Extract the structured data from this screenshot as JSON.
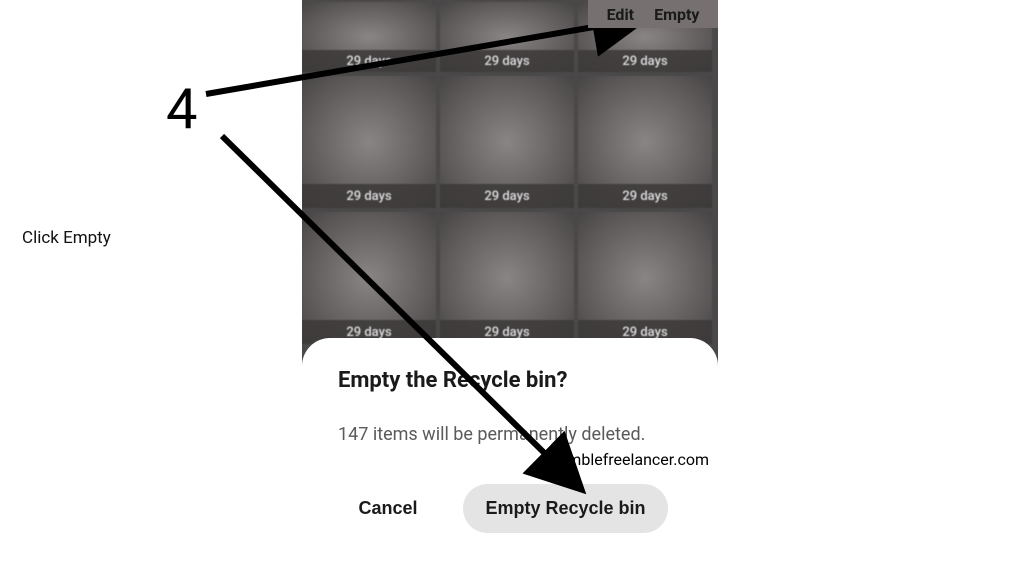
{
  "annotations": {
    "step_number": "4",
    "instruction": "Click Empty",
    "watermark": "Nimblefreelancer.com"
  },
  "top_actions": {
    "edit_label": "Edit",
    "empty_label": "Empty"
  },
  "thumbnails": {
    "label": "29 days"
  },
  "dialog": {
    "title": "Empty the Recycle bin?",
    "body": "147 items will be permanently deleted.",
    "cancel_label": "Cancel",
    "confirm_label": "Empty Recycle bin"
  }
}
